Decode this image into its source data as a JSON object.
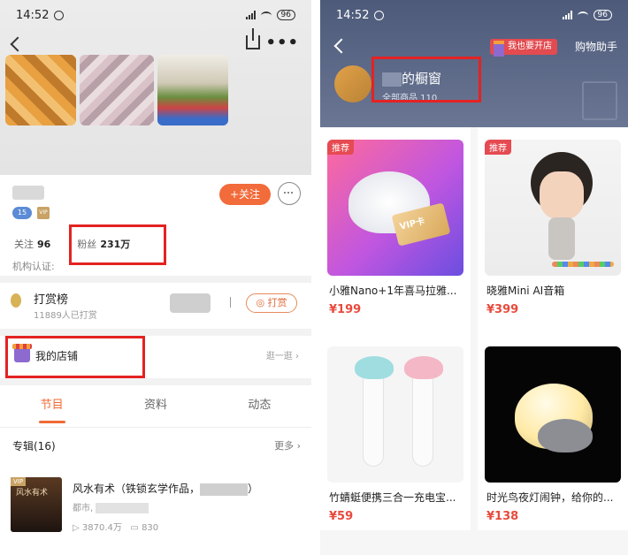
{
  "left": {
    "status": {
      "time": "14:52",
      "battery": "96"
    },
    "stats": {
      "follow_label": "关注",
      "follow_count": "96",
      "fans_label": "粉丝",
      "fans_count": "231万"
    },
    "badges": {
      "v_level": "15",
      "vip": "VIP"
    },
    "follow_button": "+关注",
    "org_cert": "机构认证:",
    "reward": {
      "title": "打赏榜",
      "subtitle": "11889人已打赏",
      "tip_button": "打赏"
    },
    "shop": {
      "label": "我的店铺",
      "go": "逛一逛"
    },
    "tabs": [
      {
        "label": "节目"
      },
      {
        "label": "资料"
      },
      {
        "label": "动态"
      }
    ],
    "album_header": {
      "label": "专辑(16)",
      "more": "更多"
    },
    "album": {
      "title_start": "风水有术（铁锁玄学作品，",
      "title_end": "）",
      "meta_start": "都市,",
      "plays": "3870.4万",
      "tracks": "830",
      "cover_text": "风水有术",
      "cover_vip": "VIP"
    }
  },
  "right": {
    "status": {
      "time": "14:52",
      "battery": "96"
    },
    "open_shop": "我也要开店",
    "assistant": "购物助手",
    "window_title": "的橱窗",
    "window_sub": "全部商品 110",
    "products": [
      {
        "tag": "推荐",
        "name": "小雅Nano+1年喜马拉雅...",
        "price": "¥199",
        "card_text": "VIP卡"
      },
      {
        "tag": "推荐",
        "name": "晓雅Mini AI音箱",
        "price": "¥399"
      },
      {
        "name": "竹蜻蜓便携三合一充电宝...",
        "price": "¥59"
      },
      {
        "name": "时光鸟夜灯闹钟，给你的...",
        "price": "¥138"
      }
    ]
  },
  "colors": {
    "accent": "#f06a35",
    "price": "#e84a3c",
    "highlight_box": "#e42222",
    "header_right": "#4d5a7a"
  }
}
